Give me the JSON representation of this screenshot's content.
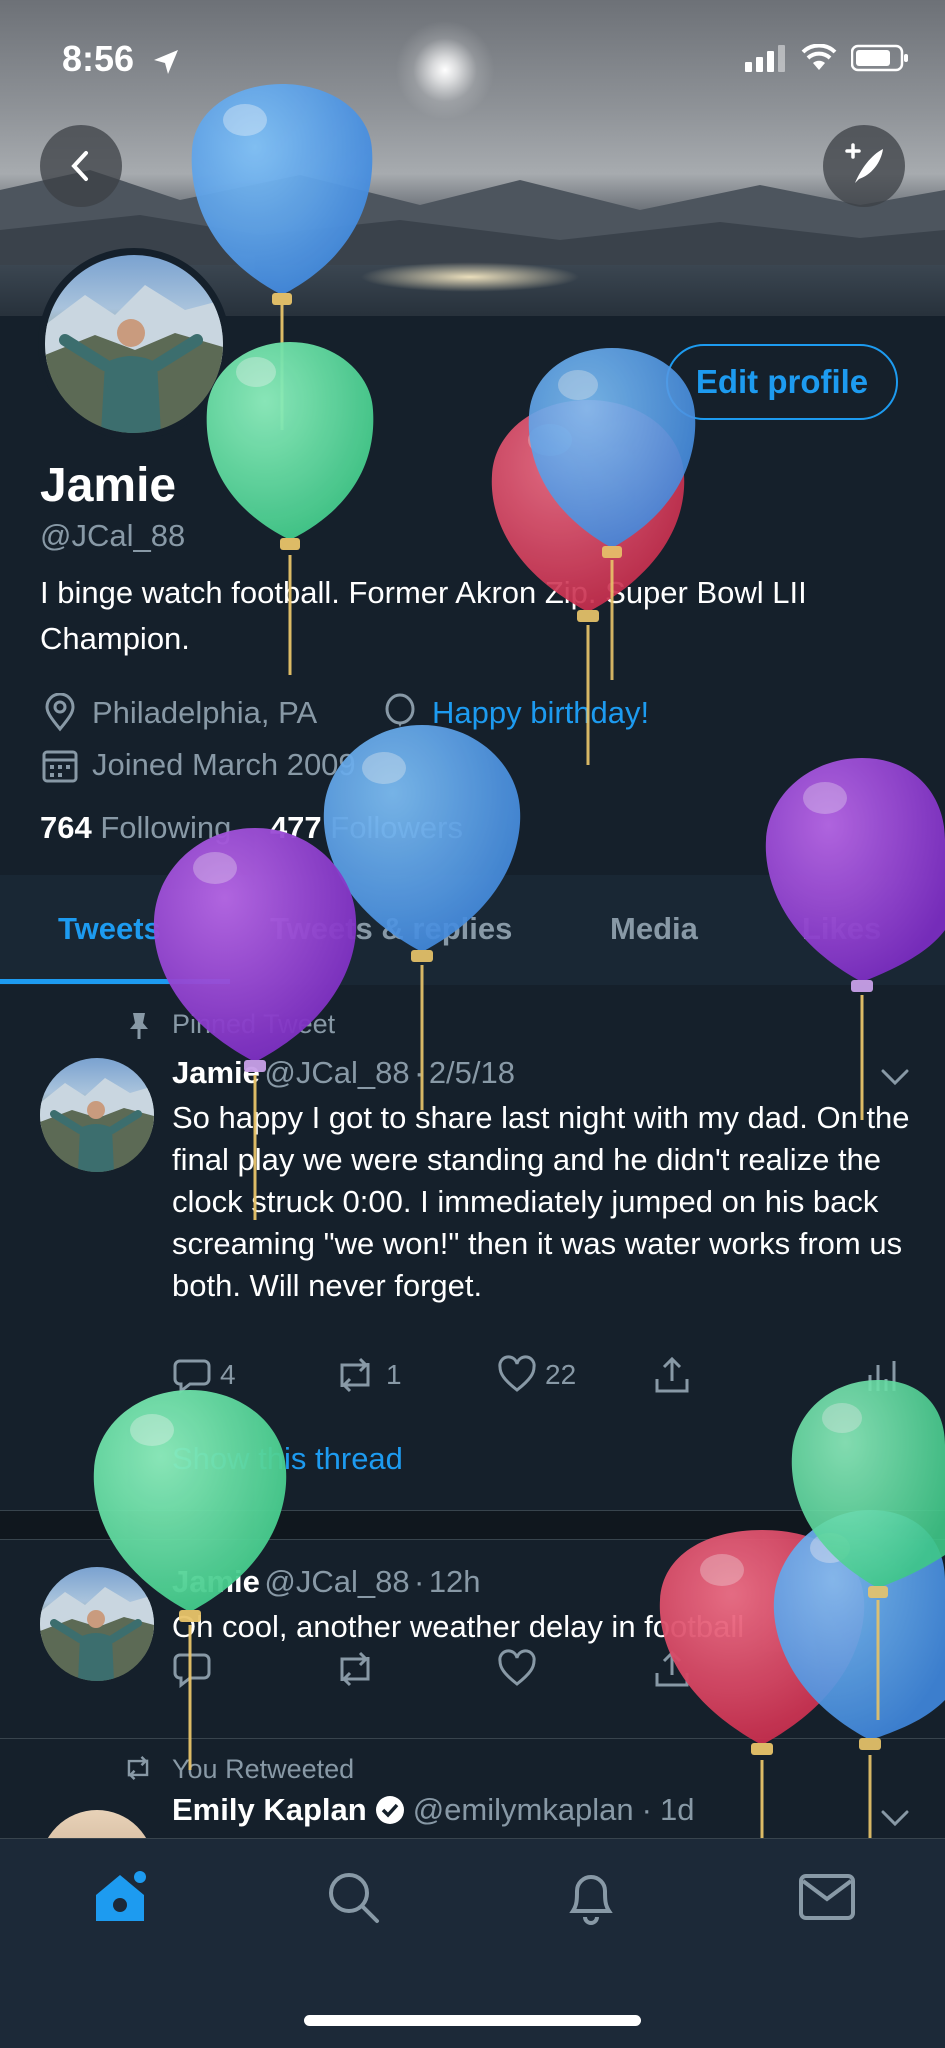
{
  "status": {
    "time": "8:56"
  },
  "profile": {
    "name": "Jamie",
    "handle": "@JCal_88",
    "bio": "I binge watch football. Former Akron Zip. Super Bowl LII Champion.",
    "location": "Philadelphia, PA",
    "birthday": "Happy birthday!",
    "joined": "Joined March 2009",
    "following_count": "764",
    "following_label": "Following",
    "followers_count": "477",
    "followers_label": "Followers",
    "edit_label": "Edit profile"
  },
  "tabs": [
    {
      "label": "Tweets"
    },
    {
      "label": "Tweets & replies"
    },
    {
      "label": "Media"
    },
    {
      "label": "Likes"
    }
  ],
  "tweets": [
    {
      "context": "Pinned Tweet",
      "name": "Jamie",
      "handle": "@JCal_88",
      "time": "2/5/18",
      "text": "So happy I got to share last night with my dad. On the final play we were standing and he didn't realize the clock struck 0:00. I immediately jumped on his back screaming \"we won!\" then it was water works from us both. Will never forget.",
      "replies": "4",
      "retweets": "1",
      "likes": "22",
      "thread": "Show this thread"
    },
    {
      "name": "Jamie",
      "handle": "@JCal_88",
      "time": "12h",
      "text": "Oh cool, another weather delay in football"
    },
    {
      "context": "You Retweeted",
      "name": "Emily Kaplan",
      "handle": "@emilymkaplan",
      "time": "1d"
    }
  ],
  "nav": {
    "items": [
      "home-icon",
      "search-icon",
      "notifications-icon",
      "messages-icon"
    ]
  },
  "colors": {
    "accent": "#1d9bf0",
    "background": "#15202b",
    "muted": "#8899a6"
  }
}
